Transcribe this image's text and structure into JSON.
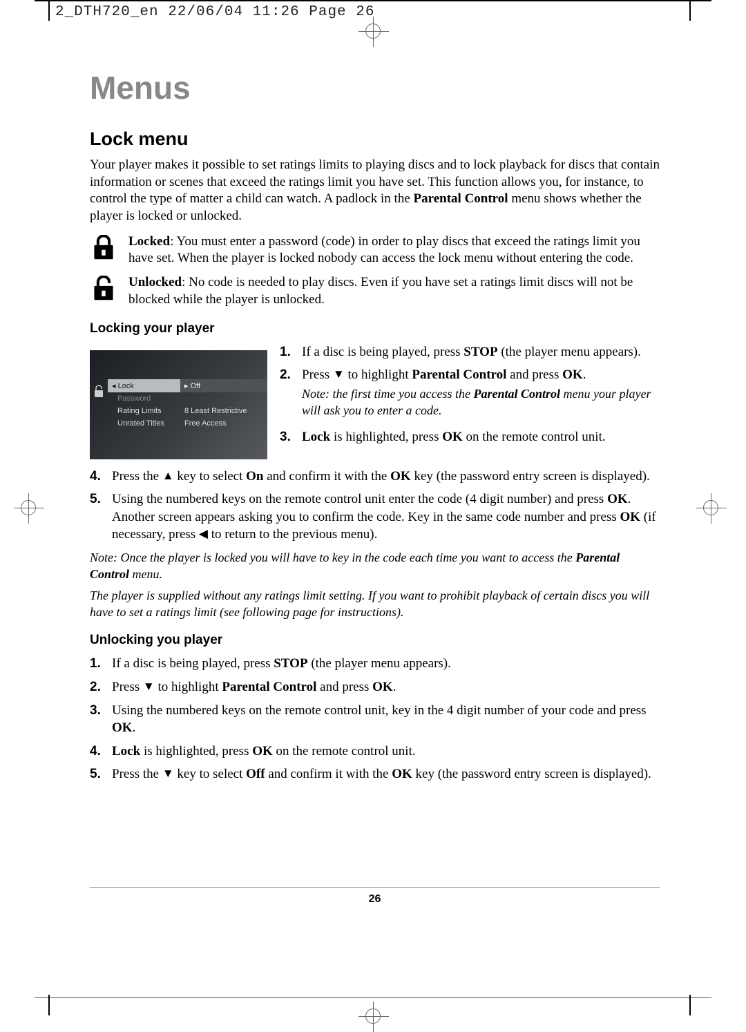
{
  "header_meta": "2_DTH720_en  22/06/04  11:26  Page 26",
  "chapter_title": "Menus",
  "lock_menu": {
    "title": "Lock menu",
    "intro_1": "Your player makes it possible to set ratings limits to playing discs and to lock playback for discs that contain information or scenes that exceed the ratings limit you have set. This function allows you, for instance, to control the type of matter a child can watch. A padlock in the ",
    "intro_bold": "Parental Control",
    "intro_2": " menu shows whether the player is locked or unlocked.",
    "locked_label": "Locked",
    "locked_text": ": You must enter a password (code) in order to play discs that exceed the ratings limit you have set. When the player is locked nobody can access the lock menu without entering the code.",
    "unlocked_label": "Unlocked",
    "unlocked_text": ": No code is needed to play discs. Even if you have set a ratings limit discs will not be blocked while the player is unlocked."
  },
  "locking": {
    "title": "Locking your player",
    "step1_a": "If a disc is being played, press ",
    "step1_b": "STOP",
    "step1_c": " (the player menu appears).",
    "step2_a": "Press ",
    "step2_b": " to highlight ",
    "step2_c": "Parental Control",
    "step2_d": " and press ",
    "step2_e": "OK",
    "step2_f": ".",
    "step2_note_a": "Note: the first time you access the ",
    "step2_note_b": "Parental Control",
    "step2_note_c": " menu your player will ask you to enter a code.",
    "step3_a": "Lock",
    "step3_b": " is highlighted, press ",
    "step3_c": "OK",
    "step3_d": " on the remote control unit.",
    "step4_a": "Press the ",
    "step4_b": " key to select ",
    "step4_c": "On",
    "step4_d": " and confirm it with the ",
    "step4_e": "OK",
    "step4_f": " key (the password entry screen is displayed).",
    "step5_a": "Using the numbered keys on the remote control unit enter the code (4 digit number) and press ",
    "step5_b": "OK",
    "step5_c": ". Another screen appears asking you to confirm the code. Key in the same code number and press ",
    "step5_d": "OK",
    "step5_e": " (if necessary, press ",
    "step5_f": " to return to the previous menu).",
    "note1_a": "Note: Once the player is locked you will have to key in the code each time you want to access the ",
    "note1_b": "Parental Control",
    "note1_c": " menu.",
    "note2": "The player is supplied without any ratings limit setting. If you want to prohibit playback of certain discs you will have to set a ratings limit (see following page for instructions)."
  },
  "unlocking": {
    "title": "Unlocking you player",
    "step1_a": "If a disc is being played, press ",
    "step1_b": "STOP",
    "step1_c": " (the player menu appears).",
    "step2_a": "Press ",
    "step2_b": " to highlight ",
    "step2_c": "Parental Control",
    "step2_d": " and press ",
    "step2_e": "OK",
    "step2_f": ".",
    "step3_a": "Using the numbered keys on the remote control unit, key in the 4 digit number of your code and press ",
    "step3_b": "OK",
    "step3_c": ".",
    "step4_a": "Lock",
    "step4_b": " is highlighted, press ",
    "step4_c": "OK",
    "step4_d": " on the remote control unit.",
    "step5_a": "Press the ",
    "step5_b": " key to select ",
    "step5_c": "Off",
    "step5_d": " and confirm it with the ",
    "step5_e": "OK",
    "step5_f": " key (the password entry screen is displayed)."
  },
  "screenshot": {
    "row1_l": "Lock",
    "row1_r": "Off",
    "row2_l": "Password",
    "row2_r": "",
    "row3_l": "Rating Limits",
    "row3_r": "8 Least Restrictive",
    "row4_l": "Unrated Titles",
    "row4_r": "Free Access"
  },
  "glyphs": {
    "down": "▼",
    "up": "▲",
    "left": "◀"
  },
  "nums": {
    "n1": "1.",
    "n2": "2.",
    "n3": "3.",
    "n4": "4.",
    "n5": "5."
  },
  "page_number": "26"
}
